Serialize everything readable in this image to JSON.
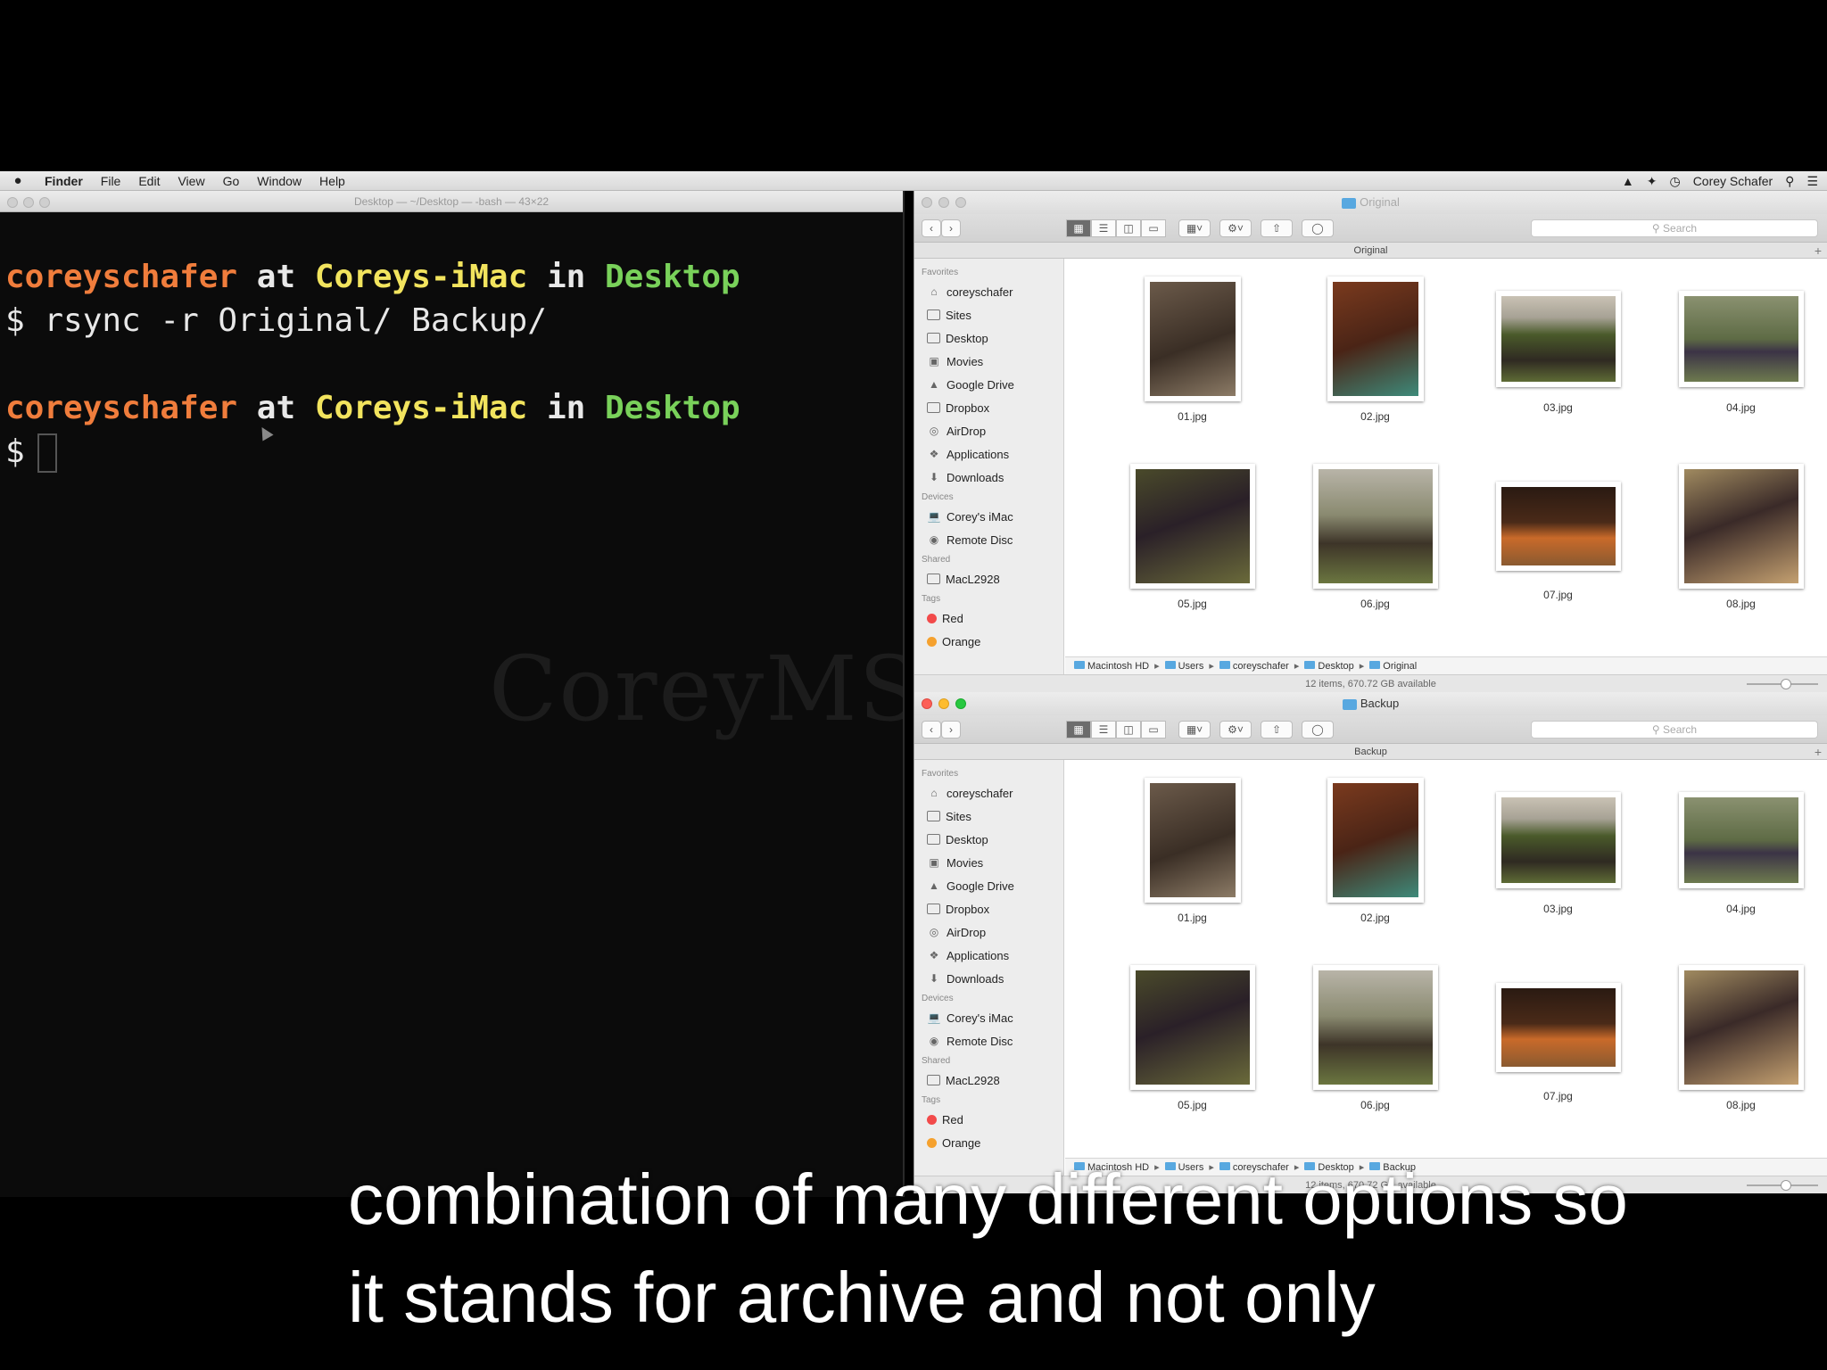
{
  "menubar": {
    "apple": "",
    "items": [
      "Finder",
      "File",
      "Edit",
      "View",
      "Go",
      "Window",
      "Help"
    ],
    "user": "Corey Schafer"
  },
  "terminal": {
    "title": "Desktop — ~/Desktop — -bash — 43×22",
    "prompt1": {
      "user": "coreyschafer",
      "at": "at",
      "host": "Coreys-iMac",
      "in": "in",
      "dir": "Desktop"
    },
    "command1": "$ rsync -r Original/ Backup/",
    "prompt2": {
      "user": "coreyschafer",
      "at": "at",
      "host": "Coreys-iMac",
      "in": "in",
      "dir": "Desktop"
    },
    "prompt_symbol": "$",
    "watermark": "CoreyMS"
  },
  "sidebar": {
    "favorites_header": "Favorites",
    "favorites": [
      "coreyschafer",
      "Sites",
      "Desktop",
      "Movies",
      "Google Drive",
      "Dropbox",
      "AirDrop",
      "Applications",
      "Downloads"
    ],
    "devices_header": "Devices",
    "devices": [
      "Corey's iMac",
      "Remote Disc"
    ],
    "shared_header": "Shared",
    "shared": [
      "MacL2928"
    ],
    "tags_header": "Tags",
    "tags": [
      "Red",
      "Orange"
    ]
  },
  "finder_original": {
    "title": "Original",
    "path_title": "Original",
    "search_placeholder": "Search",
    "files": [
      "01.jpg",
      "02.jpg",
      "03.jpg",
      "04.jpg",
      "05.jpg",
      "06.jpg",
      "07.jpg",
      "08.jpg"
    ],
    "path": [
      "Macintosh HD",
      "Users",
      "coreyschafer",
      "Desktop",
      "Original"
    ],
    "status": "12 items, 670.72 GB available"
  },
  "finder_backup": {
    "title": "Backup",
    "path_title": "Backup",
    "search_placeholder": "Search",
    "files": [
      "01.jpg",
      "02.jpg",
      "03.jpg",
      "04.jpg",
      "05.jpg",
      "06.jpg",
      "07.jpg",
      "08.jpg"
    ],
    "path": [
      "Macintosh HD",
      "Users",
      "coreyschafer",
      "Desktop",
      "Backup"
    ],
    "status": "12 items, 670.72 GB available"
  },
  "subtitles": {
    "line1": "combination of many different options so",
    "line2": "it stands for archive and not only"
  }
}
